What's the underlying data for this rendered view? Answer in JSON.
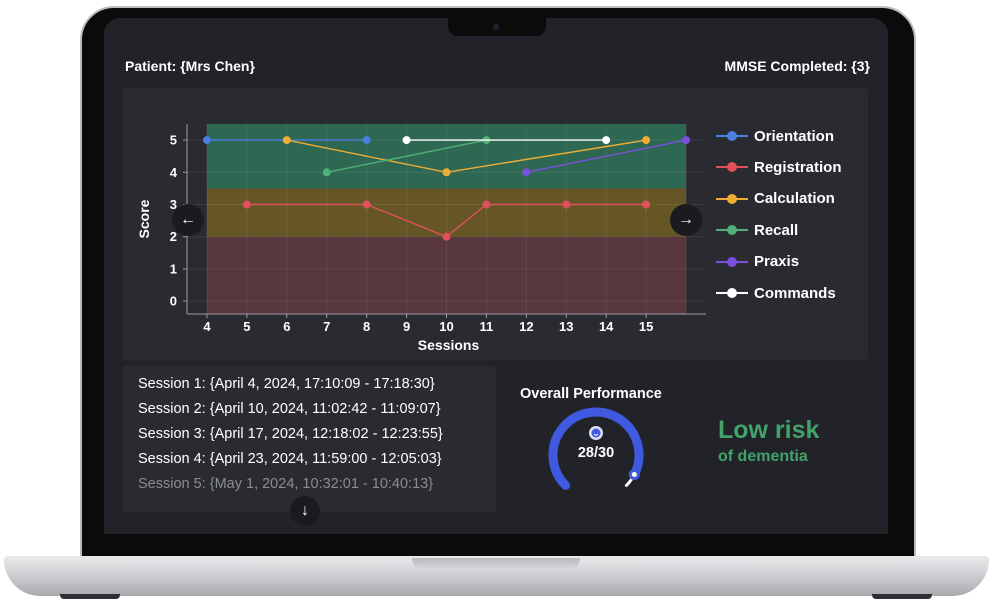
{
  "header": {
    "patient_label": "Patient: {Mrs Chen}",
    "mmse_label": "MMSE Completed: {3}"
  },
  "nav": {
    "prev_icon": "arrow-left-icon",
    "next_icon": "arrow-right-icon",
    "scroll_icon": "arrow-down-icon"
  },
  "chart_data": {
    "type": "line",
    "xlabel": "Sessions",
    "ylabel": "Score",
    "x_ticks": [
      4,
      5,
      6,
      7,
      8,
      9,
      10,
      11,
      12,
      13,
      14,
      15
    ],
    "y_ticks": [
      0,
      1,
      2,
      3,
      4,
      5
    ],
    "xlim": [
      3.5,
      16.5
    ],
    "ylim": [
      -0.4,
      5.5
    ],
    "grid": true,
    "legend_position": "right",
    "bands": [
      {
        "from": 3.5,
        "to": 5.5,
        "color": "#2f6e57"
      },
      {
        "from": 2.0,
        "to": 3.5,
        "color": "#6e5b25"
      },
      {
        "from": -0.4,
        "to": 2.0,
        "color": "#5d3840"
      }
    ],
    "series": [
      {
        "name": "Orientation",
        "color": "#4a7ee0",
        "points": [
          [
            4,
            5
          ],
          [
            8,
            5
          ]
        ]
      },
      {
        "name": "Registration",
        "color": "#e0505a",
        "points": [
          [
            5,
            3
          ],
          [
            8,
            3
          ],
          [
            10,
            2
          ],
          [
            11,
            3
          ],
          [
            13,
            3
          ],
          [
            15,
            3
          ]
        ]
      },
      {
        "name": "Calculation",
        "color": "#f0ad35",
        "points": [
          [
            6,
            5
          ],
          [
            10,
            4
          ],
          [
            15,
            5
          ]
        ]
      },
      {
        "name": "Recall",
        "color": "#4fb07a",
        "points": [
          [
            7,
            4
          ],
          [
            11,
            5
          ]
        ]
      },
      {
        "name": "Praxis",
        "color": "#7a4fe0",
        "points": [
          [
            12,
            4
          ],
          [
            16,
            5
          ]
        ]
      },
      {
        "name": "Commands",
        "color": "#ffffff",
        "points": [
          [
            9,
            5
          ],
          [
            14,
            5
          ]
        ]
      }
    ]
  },
  "sessions": {
    "items": [
      {
        "label": "Session 1: {April 4, 2024, 17:10:09 - 17:18:30}",
        "faded": false
      },
      {
        "label": "Session 2: {April 10, 2024, 11:02:42 - 11:09:07}",
        "faded": false
      },
      {
        "label": "Session 3: {April 17, 2024, 12:18:02 - 12:23:55}",
        "faded": false
      },
      {
        "label": "Session 4: {April 23, 2024, 11:59:00 - 12:05:03}",
        "faded": false
      },
      {
        "label": "Session 5: {May 1, 2024, 10:32:01 - 10:40:13}",
        "faded": true
      }
    ]
  },
  "performance": {
    "title": "Overall Performance",
    "score_text": "28/30",
    "score": 28,
    "max": 30,
    "gauge_color": "#3f5ae0",
    "track_color": "#ffffff",
    "face_icon": "smiley-face-icon",
    "risk_main": "Low risk",
    "risk_sub": "of dementia",
    "risk_color": "#41a36a"
  }
}
